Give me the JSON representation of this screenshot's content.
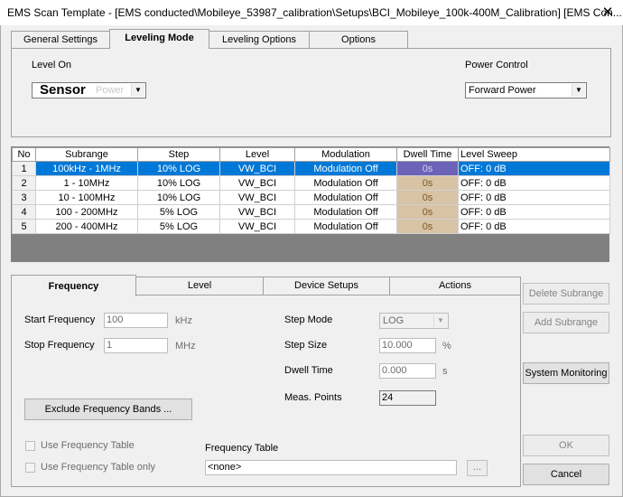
{
  "window": {
    "title": "EMS Scan Template - [EMS conducted\\Mobileye_53987_calibration\\Setups\\BCI_Mobileye_100k-400M_Calibration] [EMS Con...",
    "close_glyph": "✕"
  },
  "top_tabs": [
    {
      "label": "General Settings"
    },
    {
      "label": "Leveling Mode"
    },
    {
      "label": "Leveling Options"
    },
    {
      "label": "Options"
    }
  ],
  "leveling": {
    "level_on_label": "Level On",
    "level_on_value": "Sensor",
    "level_on_ghost": "Power",
    "power_control_label": "Power Control",
    "power_control_value": "Forward Power"
  },
  "table": {
    "headers": [
      "No",
      "Subrange",
      "Step",
      "Level",
      "Modulation",
      "Dwell Time",
      "Level Sweep"
    ],
    "rows": [
      {
        "no": "1",
        "subrange": "100kHz - 1MHz",
        "step": "10% LOG",
        "level": "VW_BCI",
        "modulation": "Modulation Off",
        "dwell": "0s",
        "sweep": "OFF: 0 dB",
        "selected": true
      },
      {
        "no": "2",
        "subrange": "1 - 10MHz",
        "step": "10% LOG",
        "level": "VW_BCI",
        "modulation": "Modulation Off",
        "dwell": "0s",
        "sweep": "OFF: 0 dB",
        "selected": false
      },
      {
        "no": "3",
        "subrange": "10 - 100MHz",
        "step": "10% LOG",
        "level": "VW_BCI",
        "modulation": "Modulation Off",
        "dwell": "0s",
        "sweep": "OFF: 0 dB",
        "selected": false
      },
      {
        "no": "4",
        "subrange": "100 - 200MHz",
        "step": "5% LOG",
        "level": "VW_BCI",
        "modulation": "Modulation Off",
        "dwell": "0s",
        "sweep": "OFF: 0 dB",
        "selected": false
      },
      {
        "no": "5",
        "subrange": "200 - 400MHz",
        "step": "5% LOG",
        "level": "VW_BCI",
        "modulation": "Modulation Off",
        "dwell": "0s",
        "sweep": "OFF: 0 dB",
        "selected": false
      }
    ]
  },
  "bottom_tabs": [
    {
      "label": "Frequency"
    },
    {
      "label": "Level"
    },
    {
      "label": "Device Setups"
    },
    {
      "label": "Actions"
    }
  ],
  "frequency": {
    "start_label": "Start Frequency",
    "start_value": "100",
    "start_unit": "kHz",
    "stop_label": "Stop Frequency",
    "stop_value": "1",
    "stop_unit": "MHz",
    "step_mode_label": "Step Mode",
    "step_mode_value": "LOG",
    "step_size_label": "Step Size",
    "step_size_value": "10.000",
    "step_size_unit": "%",
    "dwell_label": "Dwell Time",
    "dwell_value": "0.000",
    "dwell_unit": "s",
    "meas_points_label": "Meas. Points",
    "meas_points_value": "24",
    "exclude_button": "Exclude Frequency Bands ...",
    "use_freq_table": "Use Frequency Table",
    "use_freq_table_only": "Use Frequency Table only",
    "freq_table_label": "Frequency Table",
    "freq_table_value": "<none>",
    "browse_button": "..."
  },
  "side_buttons": {
    "delete_subrange": "Delete Subrange",
    "add_subrange": "Add Subrange",
    "system_monitoring": "System Monitoring",
    "ok": "OK",
    "cancel": "Cancel"
  },
  "colors": {
    "selection": "#0078d7",
    "dwell_cell": "#d8c3a5",
    "grid_empty": "#808080"
  }
}
